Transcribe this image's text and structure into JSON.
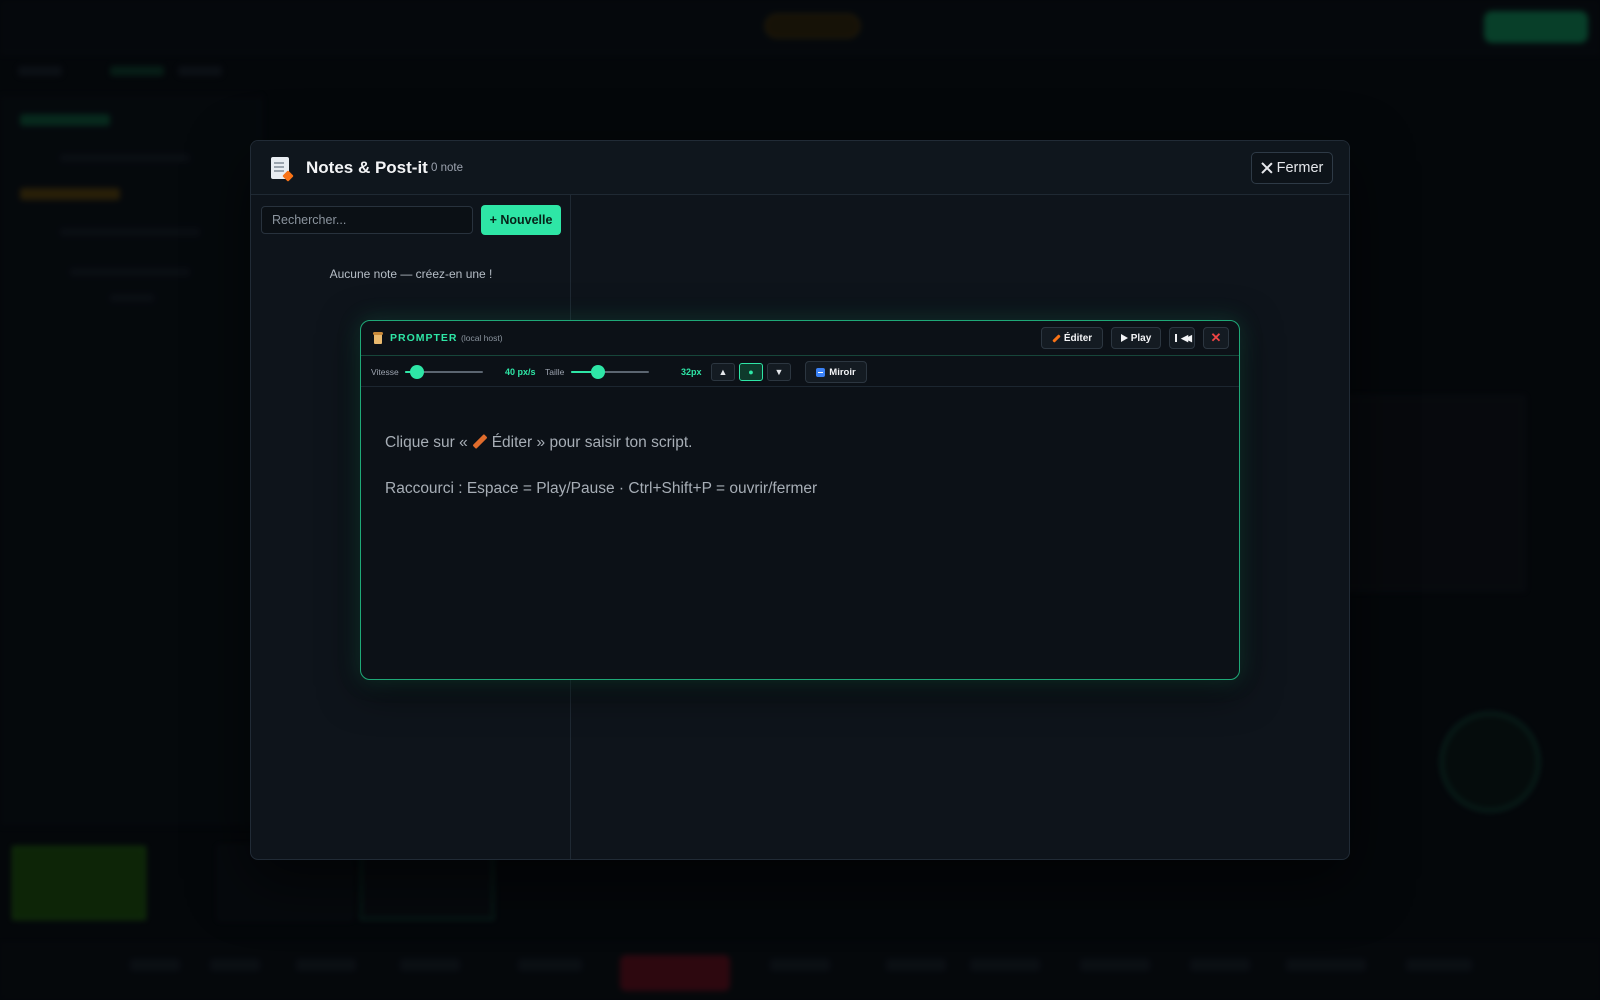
{
  "notes": {
    "title": "Notes & Post-it",
    "count": "0 note",
    "close_label": "Fermer",
    "search_placeholder": "Rechercher...",
    "new_label": "+ Nouvelle",
    "empty_message": "Aucune note — créez-en une !"
  },
  "prompter": {
    "title": "PROMPTER",
    "subtitle": "(local host)",
    "edit_label": "Éditer",
    "play_label": "Play",
    "speed_label": "Vitesse",
    "speed_value": "40 px/s",
    "speed_level": 0.15,
    "size_label": "Taille",
    "size_value": "32px",
    "size_level": 0.35,
    "align_up": "▲",
    "align_center": "●",
    "align_down": "▼",
    "mirror_label": "Miroir",
    "line1_before": "Clique sur «",
    "line1_after": "Éditer » pour saisir ton script.",
    "line2": "Raccourci : Espace = Play/Pause · Ctrl+Shift+P = ouvrir/fermer"
  },
  "colors": {
    "accent": "#2ee6a6",
    "danger": "#ef4444",
    "background": "#070b10"
  }
}
